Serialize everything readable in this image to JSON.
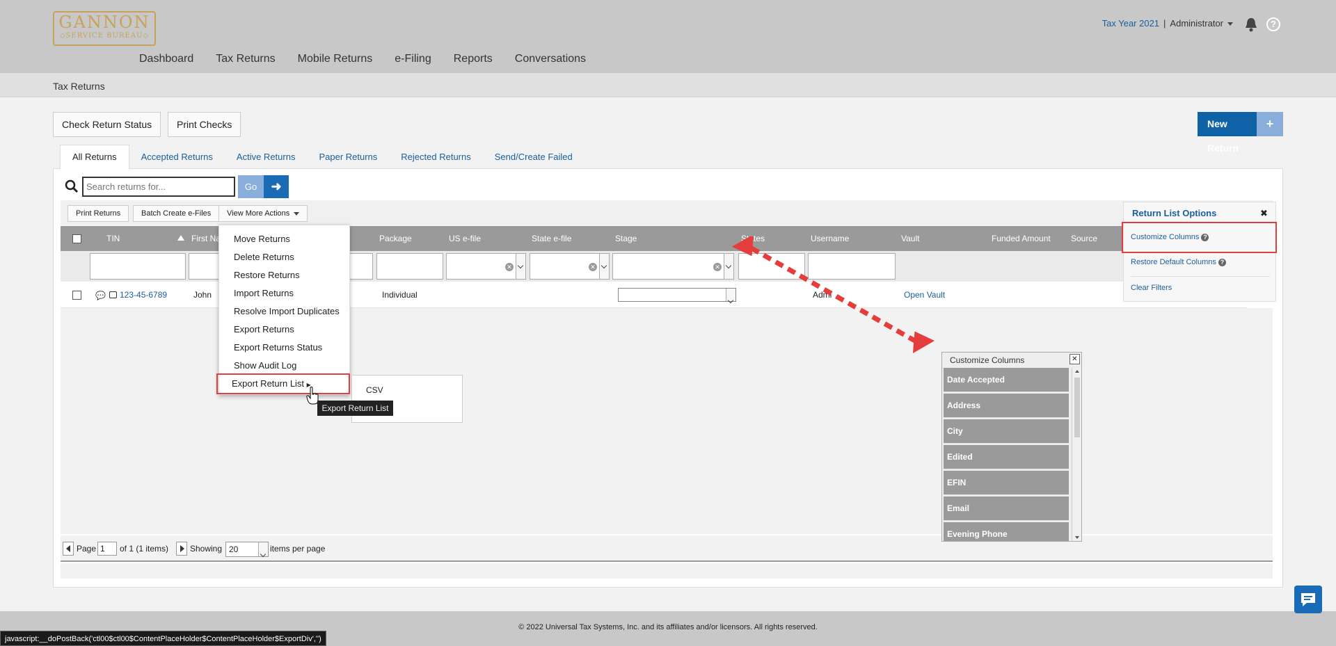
{
  "logo": {
    "line1": "GANNON",
    "line2": "◇SERVICE BUREAU◇"
  },
  "nav": [
    "Dashboard",
    "Tax Returns",
    "Mobile Returns",
    "e-Filing",
    "Reports",
    "Conversations"
  ],
  "header": {
    "tax_year": "Tax Year 2021",
    "separator": "|",
    "user": "Administrator"
  },
  "breadcrumb": "Tax Returns",
  "actions": {
    "check_status": "Check Return Status",
    "print_checks": "Print Checks",
    "new_return": "New Return",
    "new_plus": "+"
  },
  "tabs": [
    "All Returns",
    "Accepted Returns",
    "Active Returns",
    "Paper Returns",
    "Rejected Returns",
    "Send/Create Failed"
  ],
  "search": {
    "placeholder": "Search returns for...",
    "go": "Go"
  },
  "toolbar": {
    "print_returns": "Print Returns",
    "batch_efiles": "Batch Create e-Files",
    "more_actions": "View More Actions"
  },
  "grid": {
    "columns": [
      "TIN",
      "First Na",
      "Package",
      "US e-file",
      "State e-file",
      "Stage",
      "States",
      "Username",
      "Vault",
      "Funded Amount",
      "Source"
    ],
    "row": {
      "tin": "123-45-6789",
      "first_name": "John",
      "package": "Individual",
      "username": "Admi",
      "vault": "Open Vault"
    }
  },
  "menu": {
    "items": [
      "Move Returns",
      "Delete Returns",
      "Restore Returns",
      "Import Returns",
      "Resolve Import Duplicates",
      "Export Returns",
      "Export Returns Status",
      "Show Audit Log",
      "Export Return List"
    ],
    "submenu": [
      "CSV"
    ],
    "tooltip": "Export Return List"
  },
  "return_list_options": {
    "title": "Return List Options",
    "close": "✖",
    "items": [
      "Customize Columns",
      "Restore Default Columns",
      "Clear Filters"
    ]
  },
  "customize_columns": {
    "title": "Customize Columns",
    "close": "✕",
    "items": [
      "Date Accepted",
      "Address",
      "City",
      "Edited",
      "EFIN",
      "Email",
      "Evening Phone"
    ]
  },
  "pager": {
    "page_label": "Page",
    "page": "1",
    "of": "of 1 (1 items)",
    "showing": "Showing",
    "per_page": "20",
    "per_page_label": "items per page"
  },
  "footer": "© 2022 Universal Tax Systems, Inc. and its affiliates and/or licensors. All rights reserved.",
  "statusbar": "javascript:__doPostBack('ctl00$ctl00$ContentPlaceHolder$ContentPlaceHolder$ExportDiv','')",
  "colors": {
    "accent": "#1a5e9a",
    "primary_button": "#0f62a5",
    "highlight": "#e53c3c",
    "gold": "#c8a15a"
  }
}
